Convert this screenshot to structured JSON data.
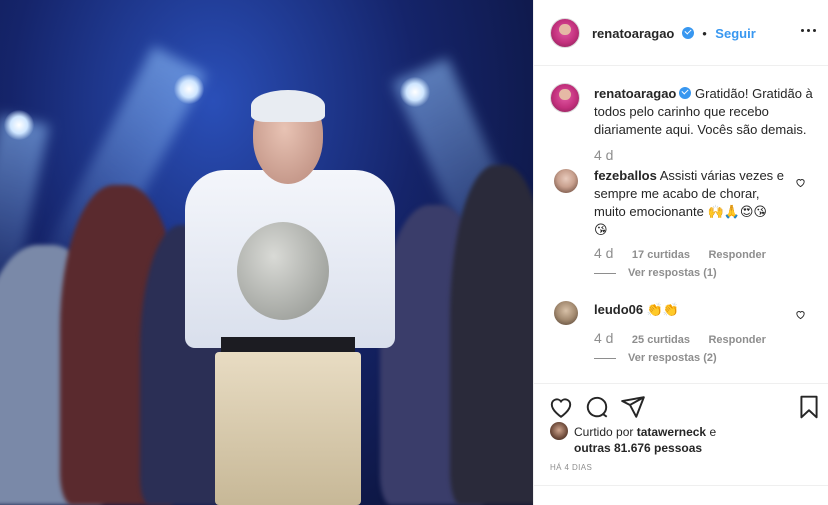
{
  "post": {
    "author": "renatoaragao",
    "follow_label": "Seguir",
    "dot": "•"
  },
  "caption": {
    "author": "renatoaragao",
    "text": "Gratidão! Gratidão à todos pelo carinho que recebo diariamente aqui. Vocês são demais.",
    "time": "4 d"
  },
  "comments": [
    {
      "author": "fezeballos",
      "text_line1": "Assisti várias vezes e",
      "text_line2": "sempre me acabo de chorar,",
      "text_line3": "muito emocionante 🙌🙏😍😘",
      "text_line4": "😘",
      "time": "4 d",
      "likes": "17 curtidas",
      "reply_label": "Responder",
      "view_replies": "Ver respostas (1)"
    },
    {
      "author": "leudo06",
      "text": "👏👏",
      "time": "4 d",
      "likes": "25 curtidas",
      "reply_label": "Responder",
      "view_replies": "Ver respostas (2)"
    }
  ],
  "likes": {
    "prefix": "Curtido por",
    "user": "tatawerneck",
    "suffix": "e",
    "line2": "outras 81.676 pessoas"
  },
  "posted_ago": "HÁ 4 DIAS",
  "colors": {
    "link": "#3897f0",
    "text": "#262626",
    "muted": "#8e8e8e",
    "border": "#efefef"
  },
  "icons": [
    "more-options-icon",
    "verified-badge-icon",
    "heart-icon",
    "comment-icon",
    "share-icon",
    "bookmark-icon"
  ]
}
